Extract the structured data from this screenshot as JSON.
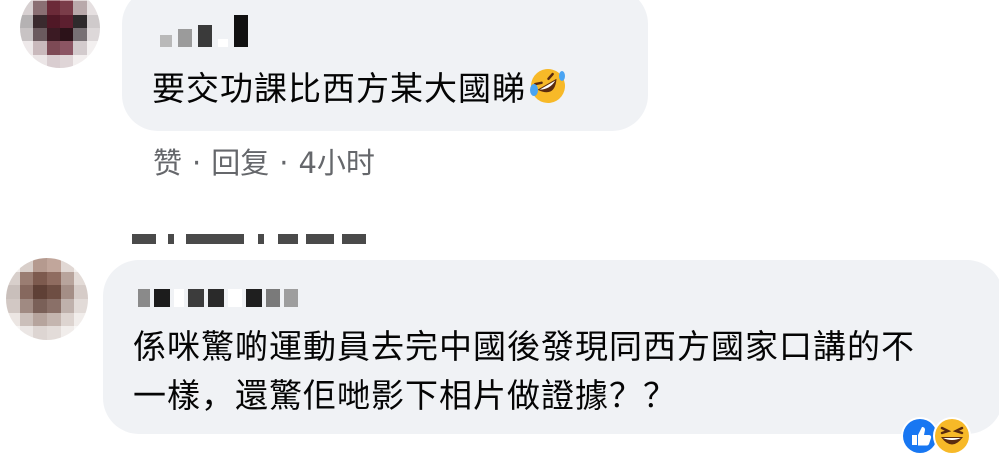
{
  "comment1": {
    "text": "要交功課比西方某大國睇",
    "actions": {
      "like": "赞",
      "reply": "回复",
      "time": "4小时"
    }
  },
  "comment2": {
    "line1": "係咪驚啲運動員去完中國後發現同西方國家口講的不",
    "line2": "一樣，還驚佢哋影下相片做證據？？"
  },
  "icons": {
    "emoji1": "rolling-on-floor-laughing-icon",
    "reaction_like": "thumbs-up-icon",
    "reaction_laugh": "laughing-icon"
  },
  "colors": {
    "bubble": "#f0f2f5",
    "meta": "#65676b",
    "like_blue": "#1877f2"
  }
}
